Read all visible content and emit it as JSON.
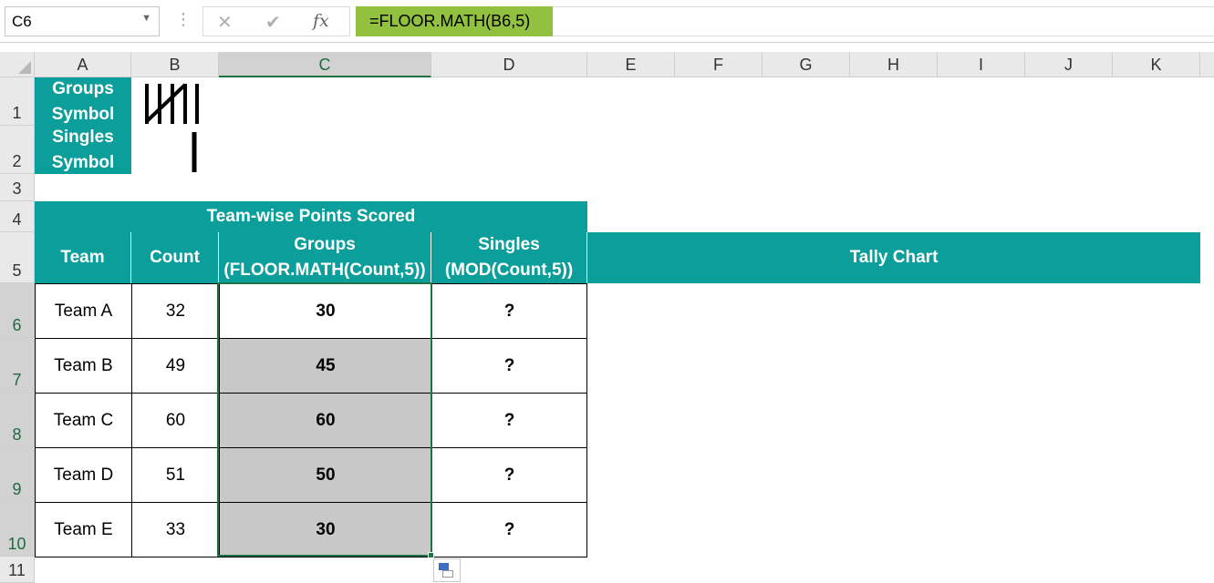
{
  "formula_bar": {
    "name_box": "C6",
    "dropdown_icon": "chevron-down-icon",
    "cancel_icon": "close-icon",
    "enter_icon": "check-icon",
    "function_icon": "fx-icon",
    "formula": "=FLOOR.MATH(B6,5)"
  },
  "columns": [
    "A",
    "B",
    "C",
    "D",
    "E",
    "F",
    "G",
    "H",
    "I",
    "J",
    "K"
  ],
  "rows": [
    "1",
    "2",
    "3",
    "4",
    "5",
    "6",
    "7",
    "8",
    "9",
    "10",
    "11"
  ],
  "symbols": {
    "groups_label": [
      "Groups",
      "Symbol"
    ],
    "singles_label": [
      "Singles",
      "Symbol"
    ]
  },
  "table": {
    "title": "Team-wise Points Scored",
    "headers": {
      "team": "Team",
      "count": "Count",
      "groups": [
        "Groups",
        "(FLOOR.MATH(Count,5))"
      ],
      "singles": [
        "Singles",
        "(MOD(Count,5))"
      ],
      "tally": "Tally Chart"
    },
    "rows": [
      {
        "team": "Team A",
        "count": "32",
        "groups": "30",
        "singles": "?"
      },
      {
        "team": "Team B",
        "count": "49",
        "groups": "45",
        "singles": "?"
      },
      {
        "team": "Team C",
        "count": "60",
        "groups": "60",
        "singles": "?"
      },
      {
        "team": "Team D",
        "count": "51",
        "groups": "50",
        "singles": "?"
      },
      {
        "team": "Team E",
        "count": "33",
        "groups": "30",
        "singles": "?"
      }
    ]
  },
  "colors": {
    "header_teal": "#0c9e9a",
    "formula_highlight": "#92c140",
    "selection_green": "#217346"
  }
}
